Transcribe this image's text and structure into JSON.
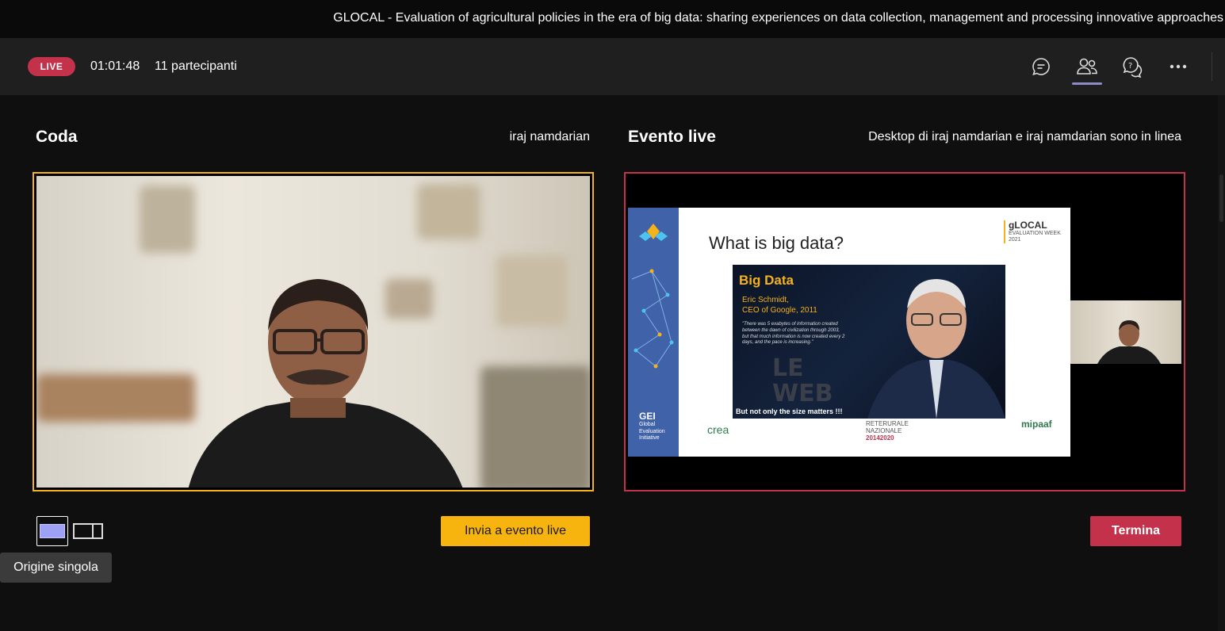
{
  "window": {
    "title": "GLOCAL - Evaluation of agricultural policies in the era of big data: sharing experiences on data collection, management and processing innovative approaches"
  },
  "toolbar": {
    "live_label": "LIVE",
    "elapsed_time": "01:01:48",
    "participants": "11 partecipanti",
    "icons": [
      "chat-icon",
      "people-icon",
      "qa-icon",
      "more-icon"
    ],
    "active_icon": "people-icon"
  },
  "queue": {
    "heading": "Coda",
    "source_name": "iraj namdarian",
    "send_button": "Invia a evento live"
  },
  "live_event": {
    "heading": "Evento live",
    "status": "Desktop di iraj namdarian e iraj namdarian sono in linea",
    "end_button": "Termina"
  },
  "slide": {
    "title": "What is big data?",
    "logo": "gLOCAL",
    "logo_sub": "EVALUATION WEEK",
    "logo_year": "2021",
    "image_title": "Big Data",
    "image_person_line1": "Eric Schmidt,",
    "image_person_line2": "CEO of Google, 2011",
    "image_quote": "\"There was 5 exabytes of information created between the dawn of civilization through 2003, but that much information is now created every 2 days, and the pace is increasing.\"",
    "image_footer": "But not only the size matters !!!",
    "footer_left": "crea",
    "footer_mid_line1": "RETERURALE",
    "footer_mid_line2": "NAZIONALE",
    "footer_mid_line3": "20142020",
    "footer_right": "mipaaf",
    "band_logo": "GEI",
    "band_line1": "Global",
    "band_line2": "Evaluation",
    "band_line3": "Initiative"
  },
  "layout": {
    "tooltip": "Origine singola",
    "selected": "single"
  },
  "colors": {
    "live_red": "#c4314b",
    "queue_border": "#f6b21a",
    "send_button": "#f8b40e",
    "accent": "#8b8cc7"
  }
}
